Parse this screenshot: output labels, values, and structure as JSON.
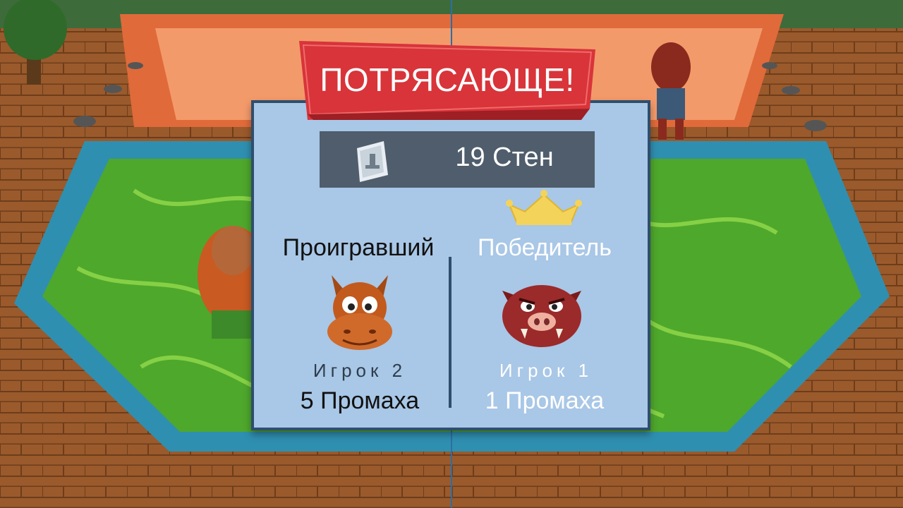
{
  "banner": {
    "title": "ПОТРЯСАЮЩЕ!"
  },
  "walls": {
    "count_label": "19 Стен",
    "icon": "wall-icon"
  },
  "loser": {
    "title": "Проигравший",
    "player": "Игрок 2",
    "misses": "5 Промаха",
    "avatar": "horse-avatar"
  },
  "winner": {
    "title": "Победитель",
    "player": "Игрок 1",
    "misses": "1 Промаха",
    "avatar": "boar-avatar",
    "badge": "crown-icon"
  },
  "colors": {
    "panel": "#a9c7e6",
    "banner": "#d8343a",
    "pool": "#4ea82c",
    "wall_bar": "#4f5d6c",
    "crown": "#f4d35a"
  }
}
